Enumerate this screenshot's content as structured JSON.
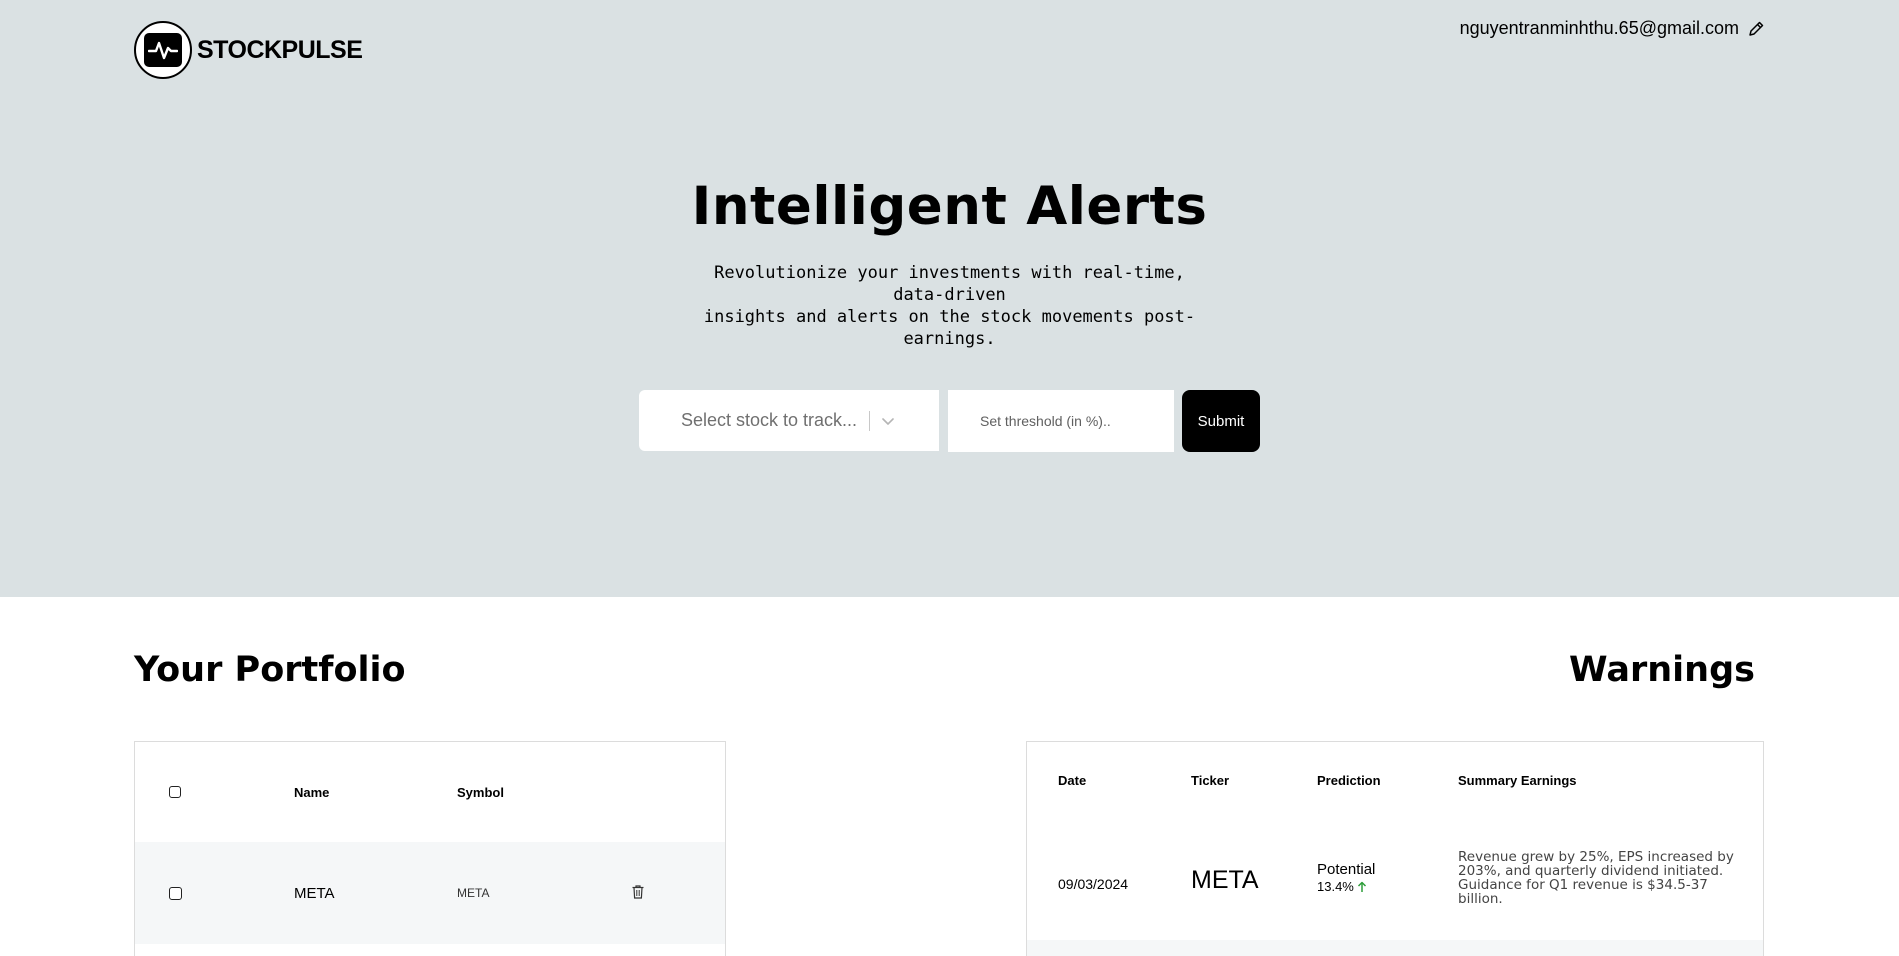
{
  "header": {
    "brand": "STOCKPULSE",
    "user_email": "nguyentranminhthu.65@gmail.com"
  },
  "hero": {
    "title": "Intelligent Alerts",
    "subtitle_line1": "Revolutionize your investments with real-time, data-driven",
    "subtitle_line2": "insights and alerts on the stock movements post-earnings."
  },
  "controls": {
    "stock_select_placeholder": "Select stock to track...",
    "threshold_placeholder": "Set threshold (in %)..",
    "submit_label": "Submit"
  },
  "portfolio": {
    "title": "Your Portfolio",
    "columns": {
      "name": "Name",
      "symbol": "Symbol"
    },
    "rows": [
      {
        "name": "META",
        "symbol": "META"
      }
    ]
  },
  "warnings": {
    "title": "Warnings",
    "columns": {
      "date": "Date",
      "ticker": "Ticker",
      "prediction": "Prediction",
      "summary": "Summary Earnings"
    },
    "rows": [
      {
        "date": "09/03/2024",
        "ticker": "META",
        "prediction": "Potential",
        "change": "13.4%",
        "summary": "Revenue grew by 25%, EPS increased by 203%, and quarterly dividend initiated. Guidance for Q1 revenue is $34.5-37 billion."
      }
    ]
  },
  "colors": {
    "hero_bg": "#dae1e3",
    "accent": "#000000",
    "up_arrow": "#2e9e3a"
  },
  "icons": [
    "pulse-logo-icon",
    "edit-pencil-icon",
    "chevron-down-icon",
    "trash-icon",
    "arrow-up-icon"
  ]
}
